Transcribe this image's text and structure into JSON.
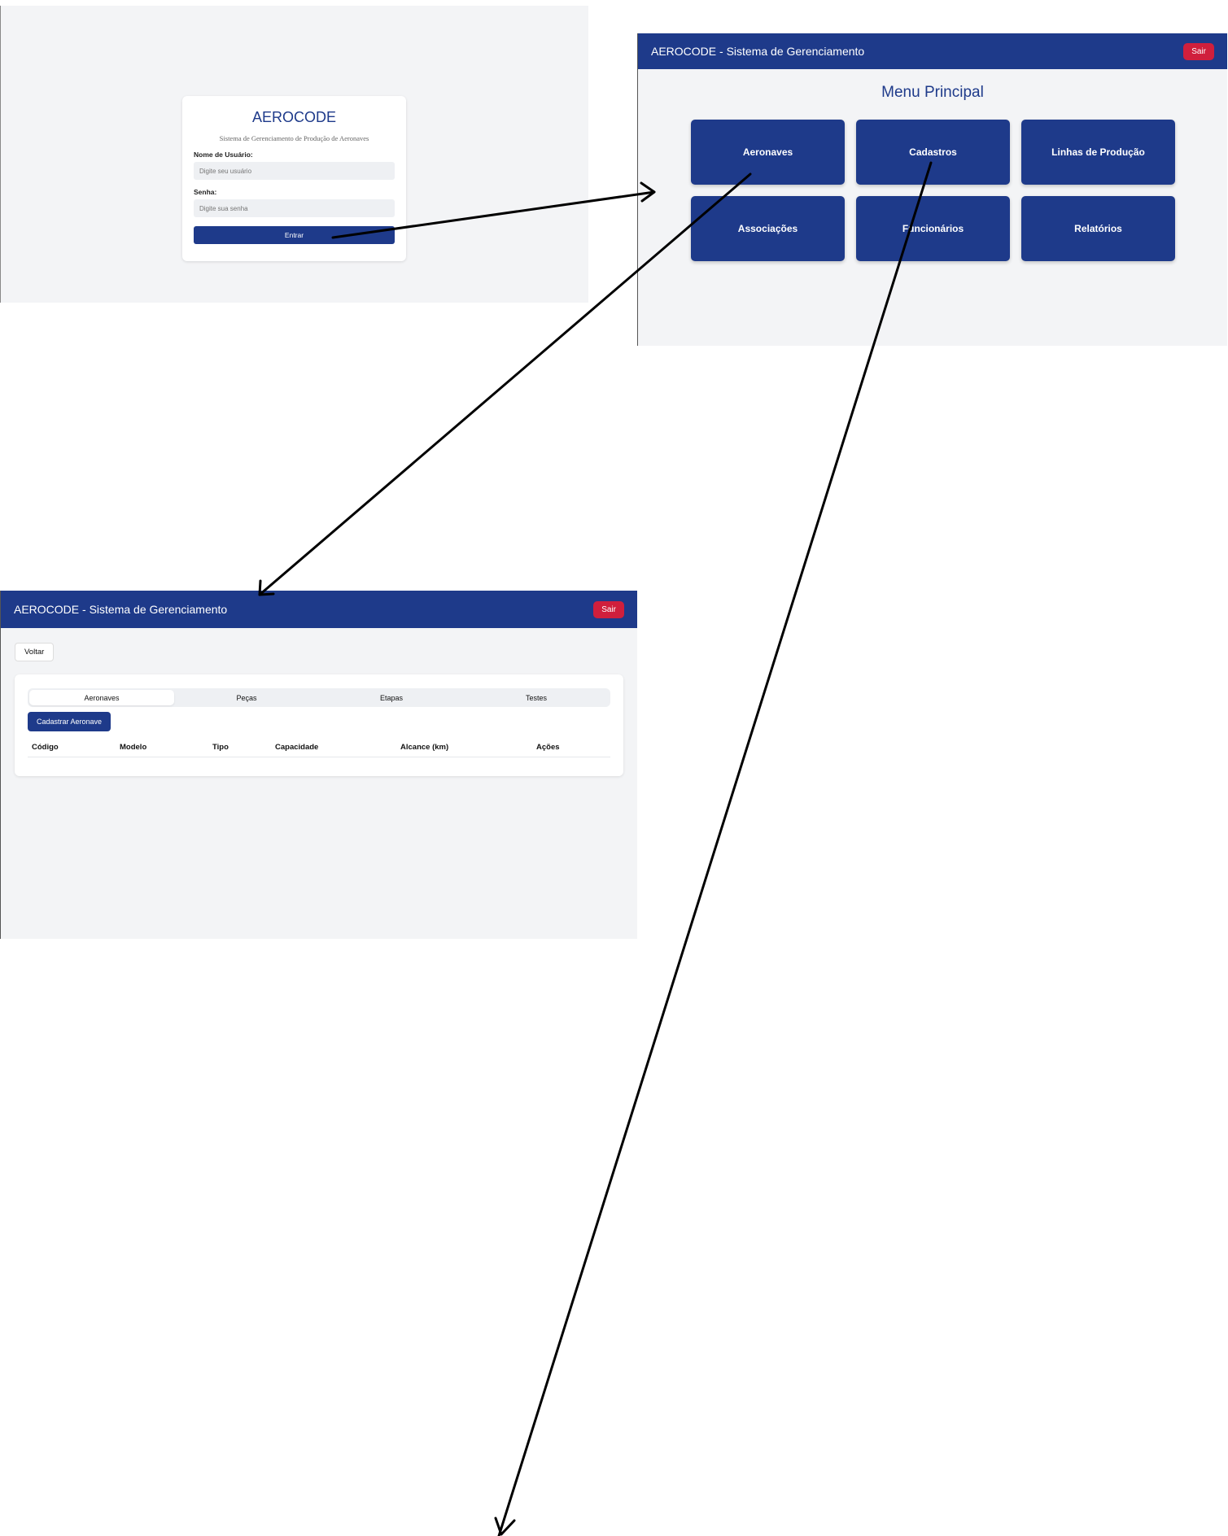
{
  "login": {
    "title": "AEROCODE",
    "subtitle": "Sistema de Gerenciamento de Produção de Aeronaves",
    "username_label": "Nome de Usuário:",
    "username_placeholder": "Digite seu usuário",
    "password_label": "Senha:",
    "password_placeholder": "Digite sua senha",
    "submit_label": "Entrar"
  },
  "menu": {
    "header_title": "AEROCODE - Sistema de Gerenciamento",
    "exit_label": "Sair",
    "page_title": "Menu Principal",
    "tiles": [
      "Aeronaves",
      "Cadastros",
      "Linhas de Produção",
      "Associações",
      "Funcionários",
      "Relatórios"
    ]
  },
  "aircraft": {
    "header_title": "AEROCODE - Sistema de Gerenciamento",
    "exit_label": "Sair",
    "back_label": "Voltar",
    "tabs": [
      "Aeronaves",
      "Peças",
      "Etapas",
      "Testes"
    ],
    "active_tab": "Aeronaves",
    "register_label": "Cadastrar Aeronave",
    "columns": [
      "Código",
      "Modelo",
      "Tipo",
      "Capacidade",
      "Alcance (km)",
      "Ações"
    ]
  },
  "colors": {
    "primary": "#1e3a8a",
    "danger": "#d01f3c",
    "background": "#f3f4f6"
  }
}
